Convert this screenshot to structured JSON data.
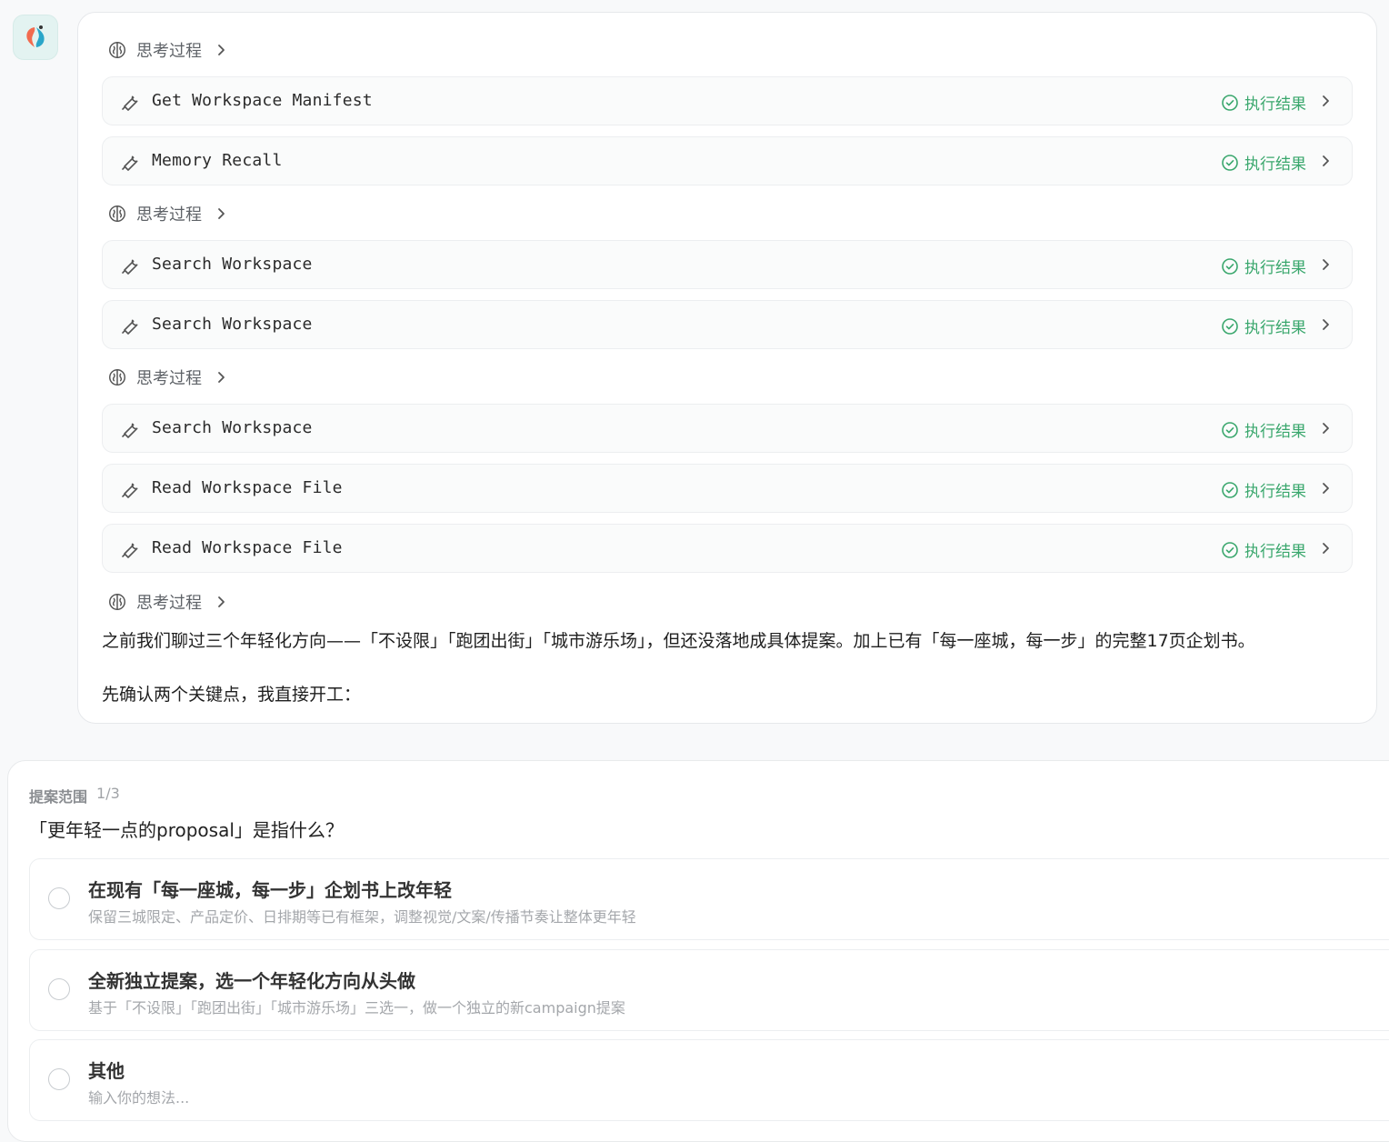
{
  "assistant": {
    "avatar_icon": "app-logo-icon",
    "steps": [
      {
        "type": "think",
        "label": "思考过程"
      },
      {
        "type": "tool",
        "name": "Get Workspace Manifest",
        "status": "执行结果"
      },
      {
        "type": "tool",
        "name": "Memory Recall",
        "status": "执行结果"
      },
      {
        "type": "think",
        "label": "思考过程"
      },
      {
        "type": "tool",
        "name": "Search Workspace",
        "status": "执行结果"
      },
      {
        "type": "tool",
        "name": "Search Workspace",
        "status": "执行结果"
      },
      {
        "type": "think",
        "label": "思考过程"
      },
      {
        "type": "tool",
        "name": "Search Workspace",
        "status": "执行结果"
      },
      {
        "type": "tool",
        "name": "Read Workspace File",
        "status": "执行结果"
      },
      {
        "type": "tool",
        "name": "Read Workspace File",
        "status": "执行结果"
      },
      {
        "type": "think",
        "label": "思考过程"
      }
    ],
    "paragraphs": [
      "之前我们聊过三个年轻化方向——「不设限」「跑团出街」「城市游乐场」，但还没落地成具体提案。加上已有「每一座城，每一步」的完整17页企划书。",
      "先确认两个关键点，我直接开工："
    ]
  },
  "question": {
    "label": "提案范围",
    "counter": "1/3",
    "title": "「更年轻一点的proposal」是指什么？",
    "options": [
      {
        "title": "在现有「每一座城，每一步」企划书上改年轻",
        "desc": "保留三城限定、产品定价、日排期等已有框架，调整视觉/文案/传播节奏让整体更年轻"
      },
      {
        "title": "全新独立提案，选一个年轻化方向从头做",
        "desc": "基于「不设限」「跑团出街」「城市游乐场」三选一，做一个独立的新campaign提案"
      },
      {
        "title": "其他",
        "desc": "输入你的想法..."
      }
    ]
  },
  "colors": {
    "success": "#3aa76d",
    "muted": "#5f6368",
    "border": "#eceef0"
  }
}
